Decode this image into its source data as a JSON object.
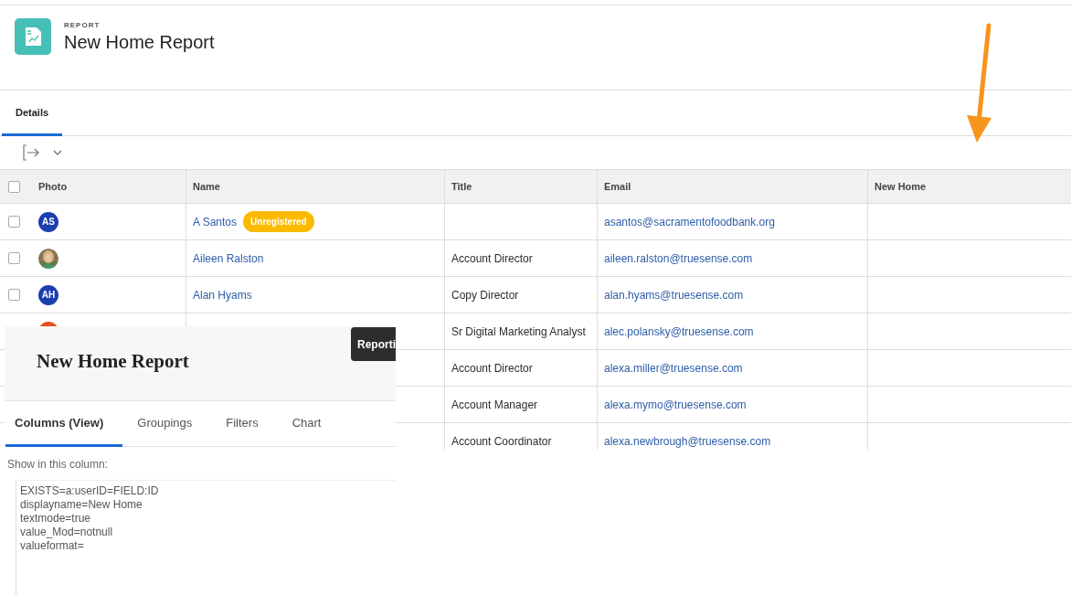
{
  "header": {
    "eyebrow": "REPORT",
    "title": "New Home Report"
  },
  "tabs": [
    {
      "label": "Details",
      "selected": true
    }
  ],
  "table": {
    "select_all": {
      "checked": false
    },
    "columns": [
      "Photo",
      "Name",
      "Title",
      "Email",
      "New Home"
    ],
    "rows": [
      {
        "checked": false,
        "avatar": {
          "kind": "initials",
          "initials": "AS",
          "color": "#1c3fae"
        },
        "name": "A Santos",
        "badge": "Unregistered",
        "title": "",
        "email": "asantos@sacramentofoodbank.org"
      },
      {
        "checked": false,
        "name": "Aileen Ralston",
        "title": "Account Director",
        "email": "aileen.ralston@truesense.com"
      },
      {
        "checked": false,
        "avatar": {
          "kind": "initials",
          "initials": "AH",
          "color": "#1c3fae"
        },
        "name": "Alan Hyams",
        "title": "Copy Director",
        "email": "alan.hyams@truesense.com"
      },
      {
        "avatar": {
          "kind": "initials",
          "color": "#e5511f"
        },
        "title": "Sr Digital Marketing Analyst",
        "email": "alec.polansky@truesense.com"
      },
      {
        "title": "Account Director",
        "email": "alexa.miller@truesense.com"
      },
      {
        "title": "Account Manager",
        "email": "alexa.mymo@truesense.com"
      },
      {
        "title": "Account Coordinator",
        "email": "alexa.newbrough@truesense.com"
      }
    ]
  },
  "panel": {
    "title": "New Home Report",
    "tooltip": "Reporti",
    "tabs": [
      {
        "label": "Columns (View)",
        "selected": true
      },
      {
        "label": "Groupings",
        "selected": false
      },
      {
        "label": "Filters",
        "selected": false
      },
      {
        "label": "Chart",
        "selected": false
      }
    ],
    "field_label": "Show in this column:",
    "code_lines": [
      "EXISTS=a:userID=FIELD:ID",
      "displayname=New Home",
      "textmode=true",
      "value_Mod=notnull",
      "valueformat="
    ]
  }
}
